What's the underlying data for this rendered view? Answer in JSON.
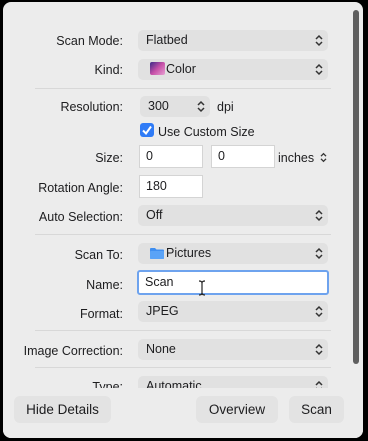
{
  "form": {
    "scan_mode": {
      "label": "Scan Mode:",
      "value": "Flatbed"
    },
    "kind": {
      "label": "Kind:",
      "value": "Color"
    },
    "resolution": {
      "label": "Resolution:",
      "value": "300",
      "unit": "dpi"
    },
    "custom_size": {
      "label": "Use Custom Size",
      "checked": true
    },
    "size": {
      "label": "Size:",
      "width": "0",
      "height": "0",
      "unit": "inches"
    },
    "rotation": {
      "label": "Rotation Angle:",
      "value": "180"
    },
    "auto_selection": {
      "label": "Auto Selection:",
      "value": "Off"
    },
    "scan_to": {
      "label": "Scan To:",
      "value": "Pictures"
    },
    "name": {
      "label": "Name:",
      "value": "Scan"
    },
    "format": {
      "label": "Format:",
      "value": "JPEG"
    },
    "image_correction": {
      "label": "Image Correction:",
      "value": "None"
    },
    "type": {
      "label": "Type:",
      "value": "Automatic"
    }
  },
  "buttons": {
    "hide_details": "Hide Details",
    "overview": "Overview",
    "scan": "Scan"
  },
  "colors": {
    "accent": "#2f7bf6",
    "focus_ring": "#6ea3ee"
  },
  "icons": {
    "popup": "chevron-up-down-icon",
    "kind": "color-swatch-icon",
    "folder": "folder-icon",
    "checkbox": "checkmark-icon",
    "cursor": "text-cursor-icon"
  }
}
